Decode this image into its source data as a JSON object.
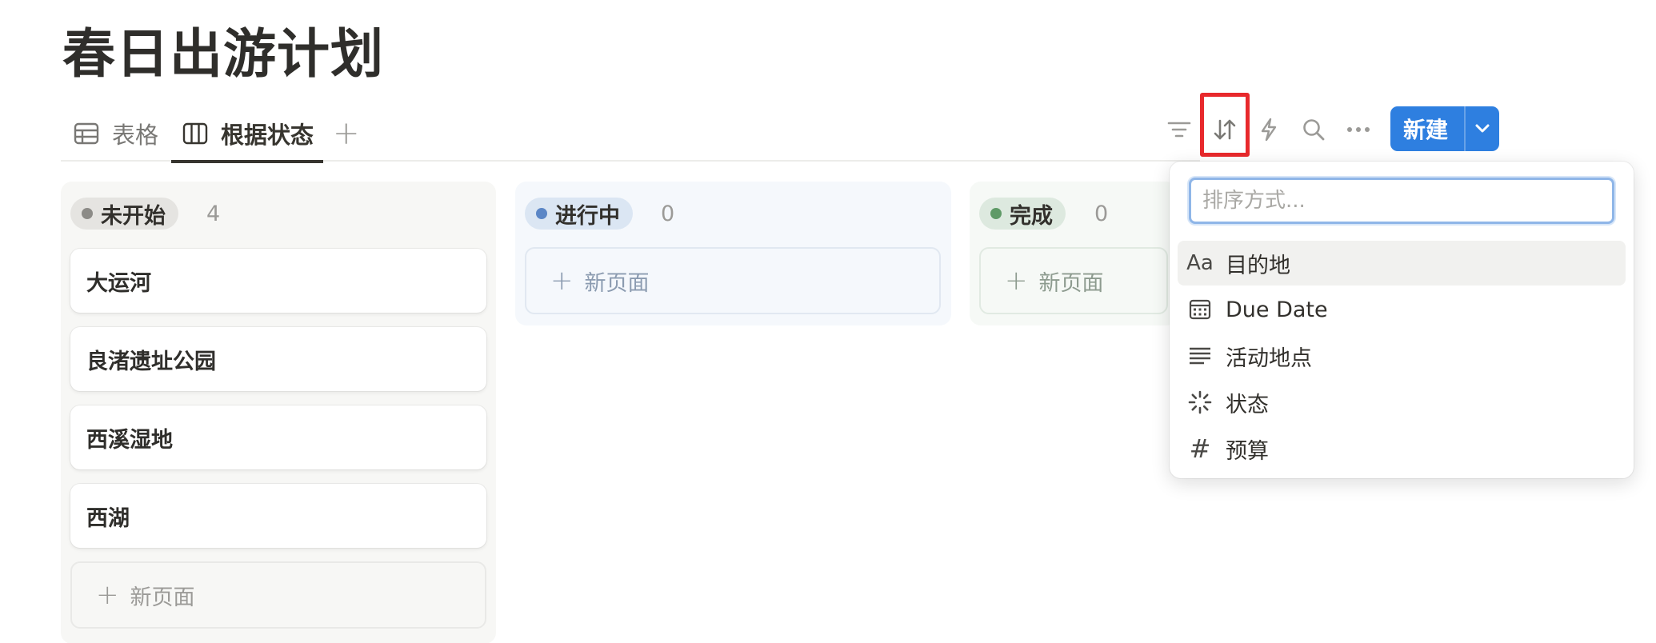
{
  "page": {
    "title": "春日出游计划"
  },
  "tabs": [
    {
      "label": "表格",
      "icon": "table-icon"
    },
    {
      "label": "根据状态",
      "icon": "board-icon",
      "active": true
    }
  ],
  "toolbar": {
    "icons": [
      "filter-icon",
      "sort-icon",
      "automation-icon",
      "search-icon",
      "more-icon"
    ],
    "new_button": "新建"
  },
  "columns": [
    {
      "status": "未开始",
      "count": "4",
      "dot_color": "#8c8b87",
      "cards": [
        "大运河",
        "良渚遗址公园",
        "西溪湿地",
        "西湖"
      ],
      "new_page": "新页面"
    },
    {
      "status": "进行中",
      "count": "0",
      "dot_color": "#5b86c6",
      "cards": [],
      "new_page": "新页面"
    },
    {
      "status": "完成",
      "count": "0",
      "dot_color": "#5f9a67",
      "cards": [],
      "new_page": "新页面"
    }
  ],
  "sort_menu": {
    "placeholder": "排序方式...",
    "items": [
      {
        "icon_text": "Aa",
        "icon": "text-property-icon",
        "label": "目的地"
      },
      {
        "icon": "calendar-icon",
        "label": "Due Date"
      },
      {
        "icon": "text-lines-icon",
        "label": "活动地点"
      },
      {
        "icon": "status-spinner-icon",
        "label": "状态"
      },
      {
        "icon_text": "#",
        "icon": "number-icon",
        "label": "预算"
      }
    ]
  },
  "colors": {
    "accent": "#2e7fe0",
    "highlight": "#e8292c"
  }
}
